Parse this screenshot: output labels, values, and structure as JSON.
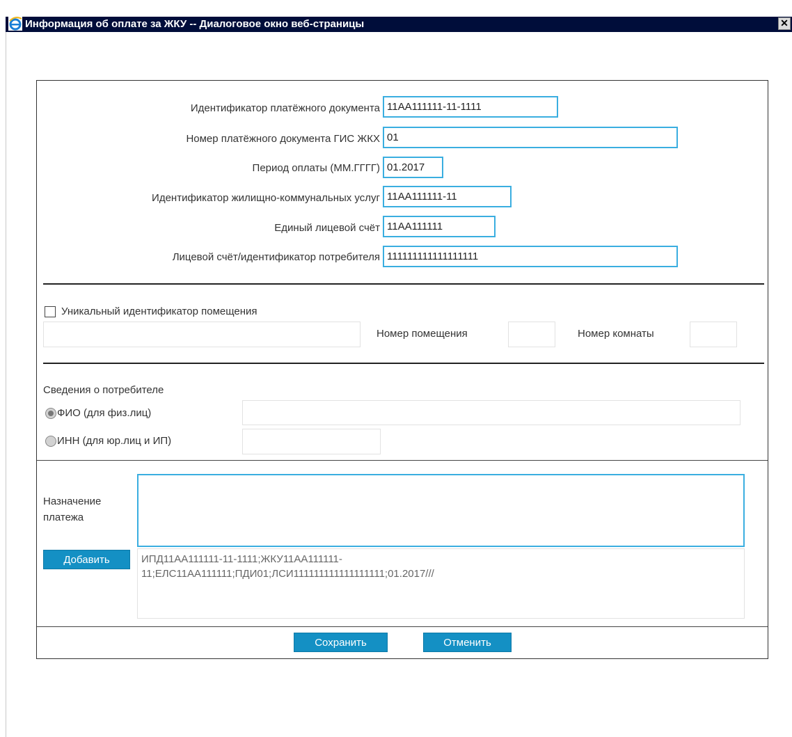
{
  "window": {
    "title": "Информация об оплате за ЖКУ -- Диалоговое окно веб-страницы",
    "close_glyph": "✕",
    "icon": "internet-explorer-icon"
  },
  "payment_fields": [
    {
      "label": "Идентификатор платёжного документа",
      "value": "11АА111111-11-1111"
    },
    {
      "label": "Номер платёжного документа ГИС ЖКХ",
      "value": "01"
    },
    {
      "label": "Период оплаты (ММ.ГГГГ)",
      "value": "01.2017"
    },
    {
      "label": "Идентификатор жилищно-коммунальных услуг",
      "value": "11АА111111-11"
    },
    {
      "label": "Единый лицевой счёт",
      "value": "11АА111111"
    },
    {
      "label": "Лицевой счёт/идентификатор потребителя",
      "value": "111111111111111111"
    }
  ],
  "premises": {
    "unique_id_label": "Уникальный идентификатор помещения",
    "unique_id_checked": false,
    "unique_id_value": "",
    "premise_number_label": "Номер помещения",
    "premise_number_value": "",
    "room_number_label": "Номер комнаты",
    "room_number_value": ""
  },
  "consumer": {
    "heading": "Сведения о потребителе",
    "fio_label": "ФИО (для физ.лиц)",
    "fio_value": "",
    "fio_selected": true,
    "inn_label": "ИНН (для юр.лиц и ИП)",
    "inn_value": "",
    "inn_selected": false
  },
  "purpose": {
    "label_line1": "Назначение",
    "label_line2": "платежа",
    "value": "",
    "add_button": "Добавить",
    "generated_line1": "ИПД11АА111111-11-1111;ЖКУ11АА111111-",
    "generated_line2": "11;ЕЛС11АА111111;ПДИ01;ЛСИ111111111111111111;01.2017///"
  },
  "actions": {
    "save": "Сохранить",
    "cancel": "Отменить"
  },
  "colors": {
    "titlebar": "#000d3a",
    "accent": "#3aaee0",
    "button": "#1490c4"
  }
}
